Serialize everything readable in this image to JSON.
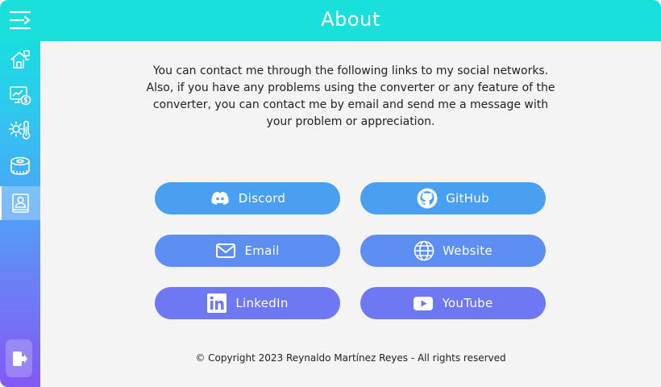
{
  "header": {
    "title": "About"
  },
  "sidebar": {
    "items": [
      {
        "name": "home",
        "icon": "home-icon"
      },
      {
        "name": "currency",
        "icon": "currency-monitor-icon"
      },
      {
        "name": "temperature",
        "icon": "temperature-icon"
      },
      {
        "name": "measure",
        "icon": "measuring-tape-icon"
      },
      {
        "name": "about",
        "icon": "contact-book-icon",
        "active": true
      }
    ],
    "logout_icon": "logout-icon"
  },
  "main": {
    "intro": "You can contact me through the following links to my social networks. Also, if you have any problems using the converter or any feature of the converter, you can contact me by email and send me a message with your problem or appreciation.",
    "links": {
      "discord": "Discord",
      "github": "GitHub",
      "email": "Email",
      "website": "Website",
      "linkedin": "LinkedIn",
      "youtube": "YouTube"
    },
    "footer": "© Copyright 2023 Reynaldo Martínez Reyes - All rights reserved"
  },
  "colors": {
    "header": "#19e0db",
    "background": "#f4f4f4",
    "button_top": "#4aa0f0",
    "button_mid": "#5d8ef2",
    "button_bottom": "#6d78f2"
  }
}
